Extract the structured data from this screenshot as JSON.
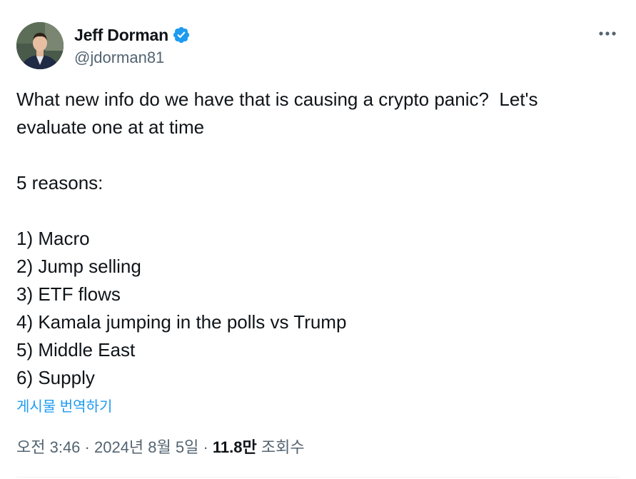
{
  "author": {
    "display_name": "Jeff Dorman",
    "handle": "@jdorman81",
    "verified": true
  },
  "tweet": {
    "lines": [
      "What new info do we have that is causing a crypto panic?  Let's",
      "evaluate one at at time",
      "",
      "5 reasons:",
      "",
      "1) Macro",
      "2) Jump selling",
      "3) ETF flows",
      "4) Kamala jumping in the polls vs Trump",
      "5) Middle East",
      "6) Supply"
    ],
    "translate_label": "게시물 번역하기"
  },
  "meta": {
    "time": "오전 3:46",
    "separator": " · ",
    "date": "2024년 8월 5일",
    "views_count": "11.8만",
    "views_label": " 조회수"
  },
  "icons": {
    "verified": "verified-badge-icon",
    "more": "more-horizontal-icon"
  },
  "colors": {
    "text_primary": "#0f1419",
    "text_secondary": "#536471",
    "accent": "#1d9bf0"
  }
}
